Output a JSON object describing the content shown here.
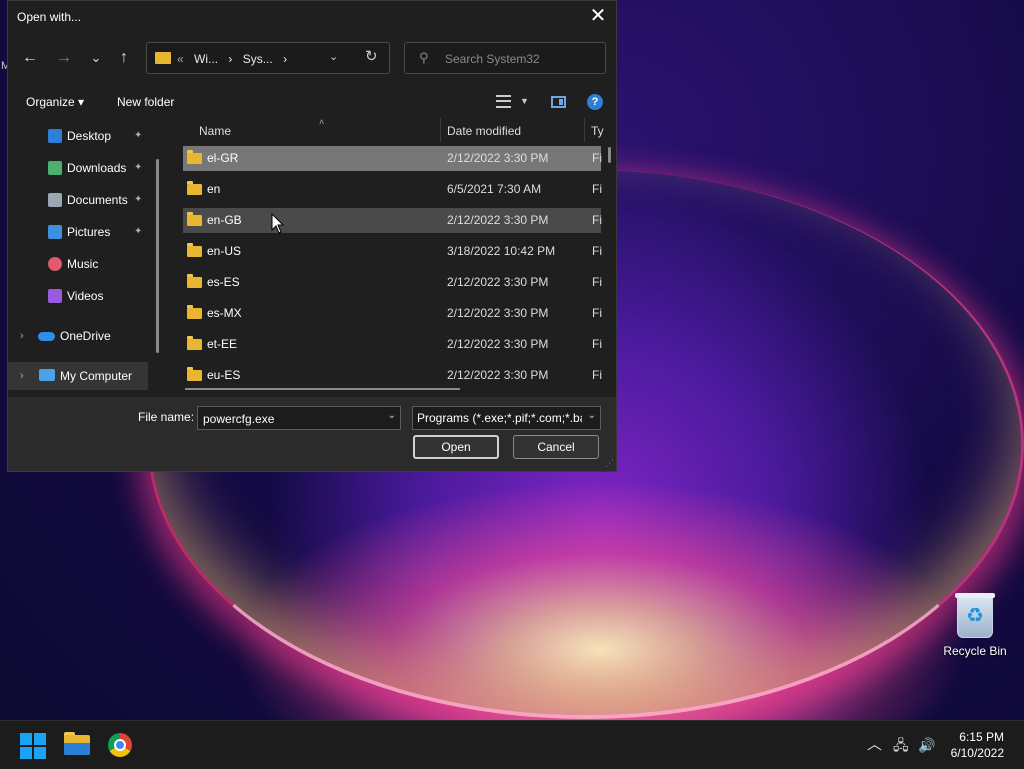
{
  "desktop": {
    "recycle_bin_label": "Recycle Bin",
    "stray_label": "M"
  },
  "dialog": {
    "title": "Open with...",
    "close": "✕",
    "nav": {
      "back": "←",
      "forward": "→",
      "recent": "⌄",
      "up": "↑"
    },
    "address": {
      "overflow": "«",
      "crumbs": [
        "Wi...",
        "›",
        "Sys...",
        "›"
      ],
      "dropdown": "⌄",
      "refresh": "↻"
    },
    "search": {
      "placeholder": "Search System32"
    },
    "toolbar": {
      "organize": "Organize ▾",
      "new_folder": "New folder",
      "help": "?"
    },
    "nav_pane": {
      "pin": "📌",
      "items": [
        {
          "label": "Desktop",
          "pinned": true,
          "color": "#2f7fd8"
        },
        {
          "label": "Downloads",
          "pinned": true,
          "color": "#4caf6e"
        },
        {
          "label": "Documents",
          "pinned": true,
          "color": "#9aa6b4"
        },
        {
          "label": "Pictures",
          "pinned": true,
          "color": "#3d8fe0"
        },
        {
          "label": "Music",
          "pinned": false,
          "color": "#e05a6a"
        },
        {
          "label": "Videos",
          "pinned": false,
          "color": "#9a5ae0"
        },
        {
          "label": "OneDrive",
          "pinned": false,
          "color": "#2f8fe8"
        },
        {
          "label": "My Computer",
          "pinned": false,
          "color": "#4aa3e8"
        }
      ],
      "expander": "›"
    },
    "columns": {
      "name": "Name",
      "date": "Date modified",
      "type": "Ty",
      "sort_arrow": "˄"
    },
    "files": [
      {
        "name": "el-GR",
        "date": "2/12/2022 3:30 PM",
        "type": "Fi",
        "state": "selected"
      },
      {
        "name": "en",
        "date": "6/5/2021 7:30 AM",
        "type": "Fi",
        "state": ""
      },
      {
        "name": "en-GB",
        "date": "2/12/2022 3:30 PM",
        "type": "Fi",
        "state": "hover"
      },
      {
        "name": "en-US",
        "date": "3/18/2022 10:42 PM",
        "type": "Fi",
        "state": ""
      },
      {
        "name": "es-ES",
        "date": "2/12/2022 3:30 PM",
        "type": "Fi",
        "state": ""
      },
      {
        "name": "es-MX",
        "date": "2/12/2022 3:30 PM",
        "type": "Fi",
        "state": ""
      },
      {
        "name": "et-EE",
        "date": "2/12/2022 3:30 PM",
        "type": "Fi",
        "state": ""
      },
      {
        "name": "eu-ES",
        "date": "2/12/2022 3:30 PM",
        "type": "Fi",
        "state": ""
      }
    ],
    "footer": {
      "file_name_label": "File name:",
      "file_name_value": "powercfg.exe",
      "file_type_value": "Programs (*.exe;*.pif;*.com;*.bat;*.cmd)",
      "dropdown": "⌄",
      "open": "Open",
      "cancel": "Cancel",
      "grip": "⋰"
    }
  },
  "taskbar": {
    "tray_chevron": "︿",
    "network_icon": "🖧",
    "volume_icon": "🔊",
    "time": "6:15 PM",
    "date": "6/10/2022"
  }
}
